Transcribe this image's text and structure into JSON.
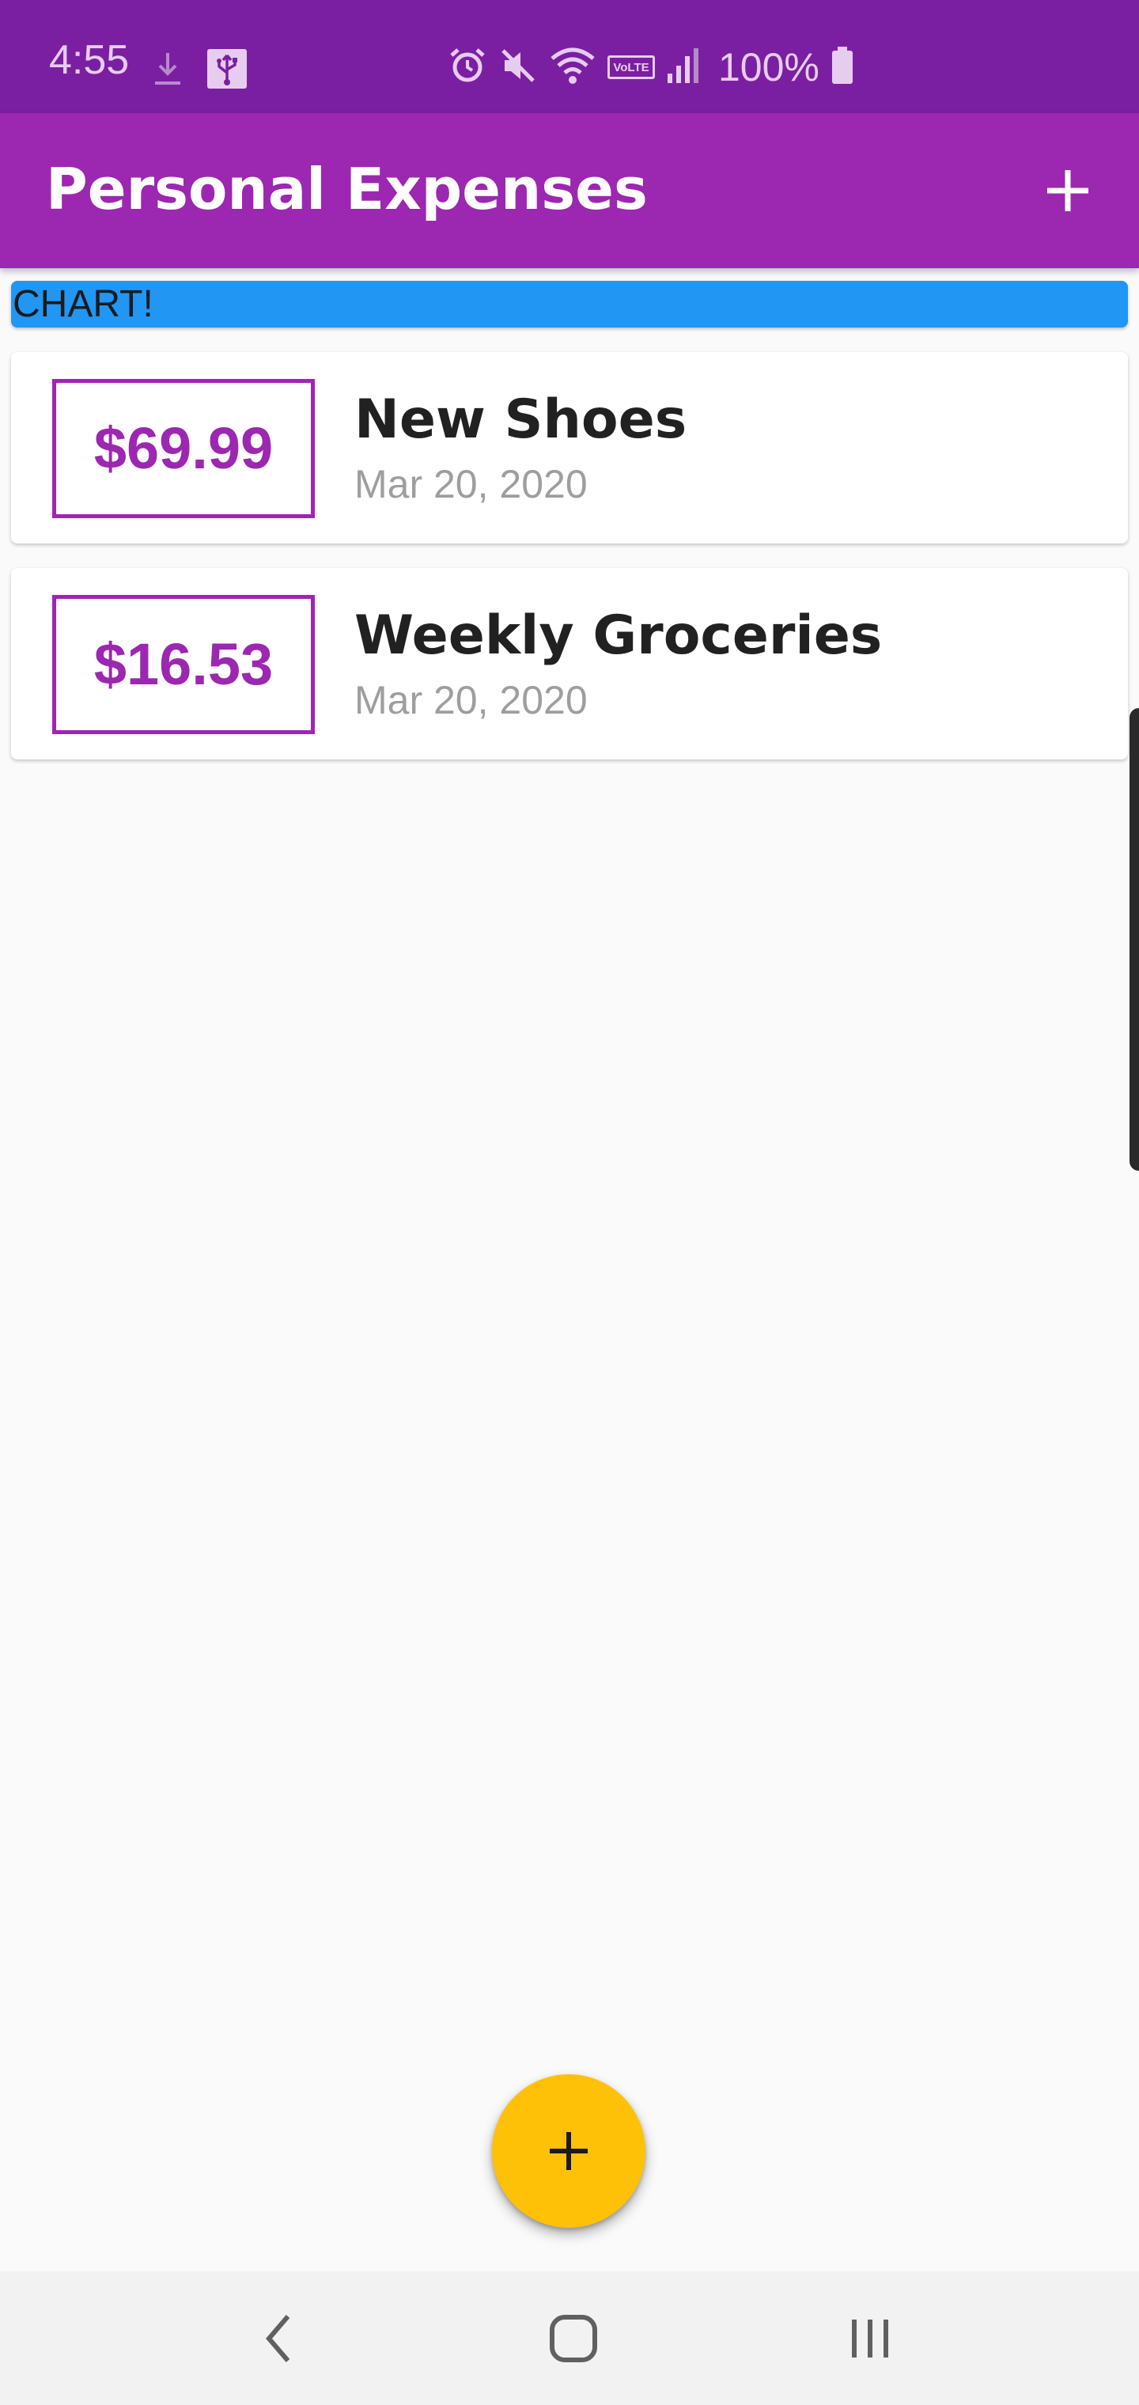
{
  "status_bar": {
    "time": "4:55",
    "battery_percent": "100%",
    "icons": [
      "download-icon",
      "usb-icon",
      "alarm-icon",
      "mute-icon",
      "wifi-icon",
      "volte-icon",
      "signal-icon",
      "battery-icon"
    ],
    "volte_label": "VoLTE"
  },
  "app_bar": {
    "title": "Personal Expenses",
    "add_icon": "plus-icon"
  },
  "chart": {
    "label": "CHART!"
  },
  "transactions": [
    {
      "amount": "$69.99",
      "title": "New Shoes",
      "date": "Mar 20, 2020"
    },
    {
      "amount": "$16.53",
      "title": "Weekly Groceries",
      "date": "Mar 20, 2020"
    }
  ],
  "fab": {
    "icon": "plus-icon"
  },
  "nav_bar": {
    "icons": [
      "back-icon",
      "home-icon",
      "recents-icon"
    ]
  },
  "colors": {
    "status_bar": "#7B1FA2",
    "primary": "#9C27B0",
    "chart": "#2196F3",
    "accent": "#FFC107",
    "background": "#FAFAFA",
    "date_text": "#9E9E9E"
  }
}
